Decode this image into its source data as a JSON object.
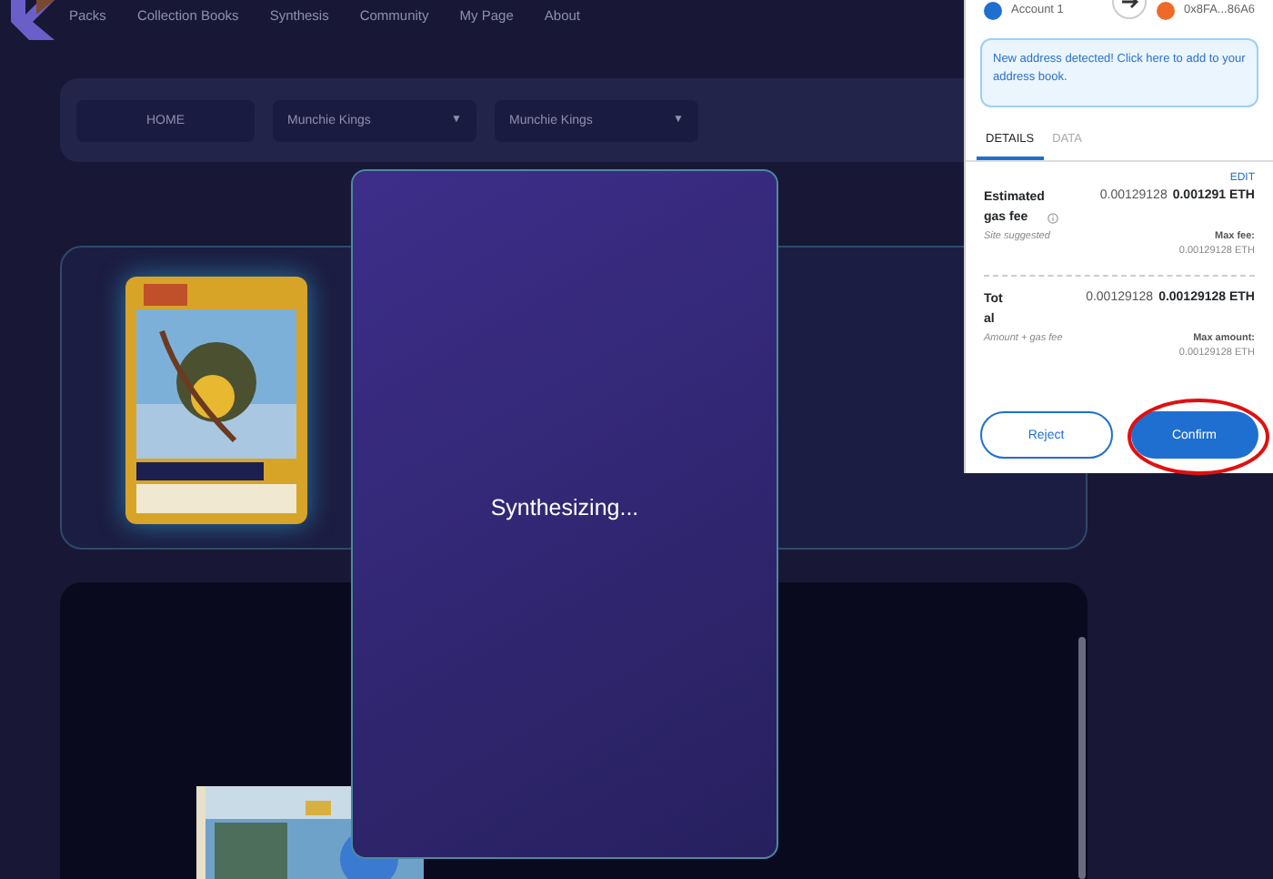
{
  "nav": {
    "items": [
      "Packs",
      "Collection Books",
      "Synthesis",
      "Community",
      "My Page",
      "About"
    ]
  },
  "filters": {
    "home": "HOME",
    "dropdowns": [
      {
        "value": "Munchie Kings",
        "caret": "▼"
      },
      {
        "value": "Munchie Kings",
        "caret": "▼"
      }
    ]
  },
  "modal": {
    "message": "Synthesizing..."
  },
  "wallet": {
    "account": "Account 1",
    "recipient": "0x8FA...86A6",
    "notice": "New address detected! Click here to add to your address book.",
    "tabs": [
      {
        "label": "DETAILS",
        "selected": true
      },
      {
        "label": "DATA",
        "selected": false
      }
    ],
    "edit": "EDIT",
    "gas": {
      "label": "Estimated gas fee",
      "value": "0.00129128",
      "value_bold": "0.001291 ETH",
      "note": "Site suggested",
      "max_label": "Max fee:",
      "max_value": "0.00129128 ETH"
    },
    "total": {
      "label": "Total",
      "value": "0.00129128",
      "value_bold": "0.00129128 ETH",
      "note": "Amount + gas fee",
      "max_label": "Max amount:",
      "max_value": "0.00129128 ETH"
    },
    "buttons": {
      "reject": "Reject",
      "confirm": "Confirm"
    }
  }
}
